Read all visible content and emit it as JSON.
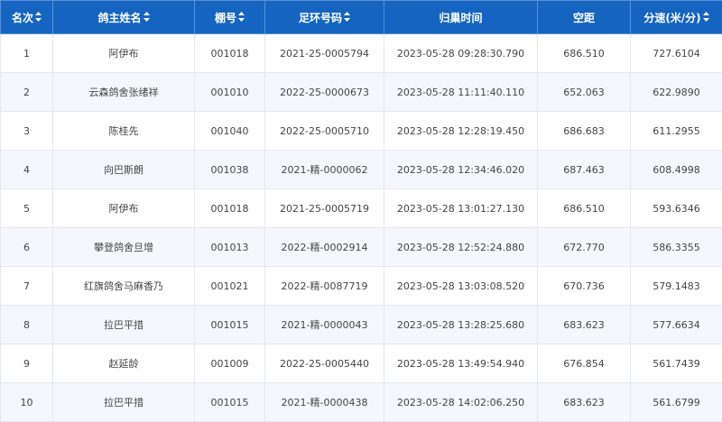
{
  "table": {
    "headers": [
      {
        "label": "名次",
        "sortable": true
      },
      {
        "label": "鸽主姓名",
        "sortable": true
      },
      {
        "label": "棚号",
        "sortable": true
      },
      {
        "label": "足环号码",
        "sortable": true
      },
      {
        "label": "归巢时间",
        "sortable": false
      },
      {
        "label": "空距",
        "sortable": false
      },
      {
        "label": "分速(米/分)",
        "sortable": true
      }
    ],
    "sort_icon": "sort-updown-icon",
    "colors": {
      "header_bg": "#1565c0",
      "header_text": "#ffffff",
      "row_alt": "#f4f8fc"
    },
    "rows": [
      [
        "1",
        "阿伊布",
        "001018",
        "2021-25-0005794",
        "2023-05-28 09:28:30.790",
        "686.510",
        "727.6104"
      ],
      [
        "2",
        "云森鸽舍张绪祥",
        "001010",
        "2022-25-0000673",
        "2023-05-28 11:11:40.110",
        "652.063",
        "622.9890"
      ],
      [
        "3",
        "陈桂先",
        "001040",
        "2022-25-0005710",
        "2023-05-28 12:28:19.450",
        "686.683",
        "611.2955"
      ],
      [
        "4",
        "向巴斯朗",
        "001038",
        "2021-精-0000062",
        "2023-05-28 12:34:46.020",
        "687.463",
        "608.4998"
      ],
      [
        "5",
        "阿伊布",
        "001018",
        "2021-25-0005719",
        "2023-05-28 13:01:27.130",
        "686.510",
        "593.6346"
      ],
      [
        "6",
        "攀登鸽舍旦增",
        "001013",
        "2022-精-0002914",
        "2023-05-28 12:52:24.880",
        "672.770",
        "586.3355"
      ],
      [
        "7",
        "红旗鸽舍马麻香乃",
        "001021",
        "2022-精-0087719",
        "2023-05-28 13:03:08.520",
        "670.736",
        "579.1483"
      ],
      [
        "8",
        "拉巴平措",
        "001015",
        "2021-精-0000043",
        "2023-05-28 13:28:25.680",
        "683.623",
        "577.6634"
      ],
      [
        "9",
        "赵延龄",
        "001009",
        "2022-25-0005440",
        "2023-05-28 13:49:54.940",
        "676.854",
        "561.7439"
      ],
      [
        "10",
        "拉巴平措",
        "001015",
        "2021-精-0000438",
        "2023-05-28 14:02:06.250",
        "683.623",
        "561.6799"
      ]
    ]
  }
}
